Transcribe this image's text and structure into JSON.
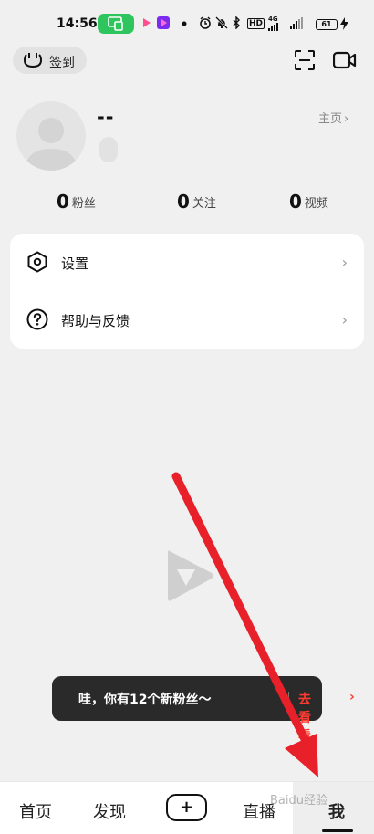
{
  "status_bar": {
    "time": "14:56",
    "network_label": "HD",
    "signal_label": "4G",
    "battery": "61"
  },
  "top_bar": {
    "signin_label": "签到"
  },
  "profile": {
    "username": "--",
    "homepage_label": "主页",
    "homepage_chevron": "›"
  },
  "stats": [
    {
      "value": "0",
      "label": "粉丝"
    },
    {
      "value": "0",
      "label": "关注"
    },
    {
      "value": "0",
      "label": "视频"
    }
  ],
  "menu": [
    {
      "label": "设置",
      "icon": "hexagon-settings-icon",
      "chevron": "›"
    },
    {
      "label": "帮助与反馈",
      "icon": "help-circle-icon",
      "chevron": "›"
    }
  ],
  "toast": {
    "message": "哇，你有12个新粉丝～",
    "action": "去看看",
    "chevron": "›"
  },
  "bottom_nav": {
    "items": [
      "首页",
      "发现",
      "+",
      "直播",
      "我"
    ],
    "active": "我"
  },
  "watermark": "Baidu经验",
  "colors": {
    "background": "#f0f0f0",
    "card": "#ffffff",
    "toast_bg": "#2a2a2a",
    "toast_action": "#ff3b30",
    "status_green": "#2ec55e",
    "annotation_arrow": "#e8202a"
  }
}
